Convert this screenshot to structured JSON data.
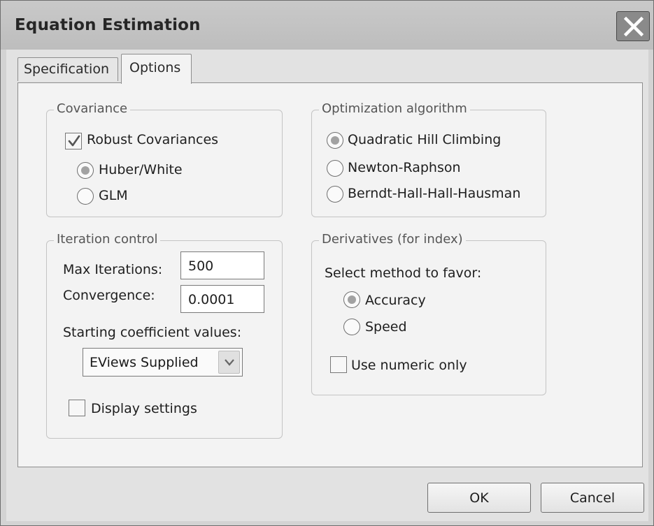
{
  "window": {
    "title": "Equation Estimation"
  },
  "tabs": [
    {
      "label": "Specification",
      "active": false
    },
    {
      "label": "Options",
      "active": true
    }
  ],
  "covariance": {
    "legend": "Covariance",
    "robust_label": "Robust Covariances",
    "robust_checked": true,
    "options": [
      {
        "label": "Huber/White",
        "selected": true
      },
      {
        "label": "GLM",
        "selected": false
      }
    ]
  },
  "optimization": {
    "legend": "Optimization algorithm",
    "options": [
      {
        "label": "Quadratic Hill Climbing",
        "selected": true
      },
      {
        "label": "Newton-Raphson",
        "selected": false
      },
      {
        "label": "Berndt-Hall-Hall-Hausman",
        "selected": false
      }
    ]
  },
  "iteration": {
    "legend": "Iteration control",
    "max_iter_label": "Max Iterations:",
    "max_iter_value": "500",
    "convergence_label": "Convergence:",
    "convergence_value": "0.0001",
    "start_label": "Starting coefficient values:",
    "start_value": "EViews Supplied",
    "display_label": "Display settings",
    "display_checked": false
  },
  "derivatives": {
    "legend": "Derivatives (for index)",
    "prompt": "Select method to favor:",
    "options": [
      {
        "label": "Accuracy",
        "selected": true
      },
      {
        "label": "Speed",
        "selected": false
      }
    ],
    "numeric_label": "Use numeric only",
    "numeric_checked": false
  },
  "buttons": {
    "ok": "OK",
    "cancel": "Cancel"
  },
  "icons": {
    "close": "close-icon",
    "check": "checkmark-icon",
    "dropdown": "chevron-down-icon"
  }
}
